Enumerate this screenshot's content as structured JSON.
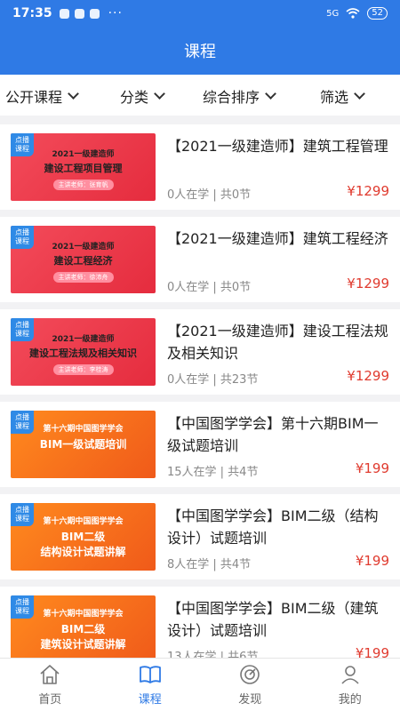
{
  "status": {
    "time": "17:35",
    "dots": "···",
    "network": "5G",
    "battery": "52"
  },
  "header": {
    "title": "课程"
  },
  "filters": [
    {
      "label": "公开课程"
    },
    {
      "label": "分类"
    },
    {
      "label": "综合排序"
    },
    {
      "label": "筛选"
    }
  ],
  "courses": [
    {
      "badge": "点播课程",
      "thumb_top": "2021一级建造师",
      "thumb_main": "建设工程项目管理",
      "thumb_sub": "主讲老师：张育帆",
      "title": "【2021一级建造师】建筑工程管理",
      "meta": "0人在学 | 共0节",
      "price": "¥1299",
      "theme": "red"
    },
    {
      "badge": "点播课程",
      "thumb_top": "2021一级建造师",
      "thumb_main": "建设工程经济",
      "thumb_sub": "主讲老师：徐沛舟",
      "title": "【2021一级建造师】建筑工程经济",
      "meta": "0人在学 | 共0节",
      "price": "¥1299",
      "theme": "red"
    },
    {
      "badge": "点播课程",
      "thumb_top": "2021一级建造师",
      "thumb_main": "建设工程法规及相关知识",
      "thumb_sub": "主讲老师：李桂涛",
      "title": "【2021一级建造师】建设工程法规及相关知识",
      "meta": "0人在学 | 共23节",
      "price": "¥1299",
      "theme": "red"
    },
    {
      "badge": "点播课程",
      "thumb_top": "第十六期中国图学学会",
      "thumb_main": "BIM一级试题培训",
      "thumb_sub": "",
      "title": "【中国图学学会】第十六期BIM一级试题培训",
      "meta": "15人在学 | 共4节",
      "price": "¥199",
      "theme": "orange"
    },
    {
      "badge": "点播课程",
      "thumb_top": "第十六期中国图学学会",
      "thumb_main": "BIM二级",
      "thumb_sub": "结构设计试题讲解",
      "title": "【中国图学学会】BIM二级（结构设计）试题培训",
      "meta": "8人在学 | 共4节",
      "price": "¥199",
      "theme": "orange"
    },
    {
      "badge": "点播课程",
      "thumb_top": "第十六期中国图学学会",
      "thumb_main": "BIM二级",
      "thumb_sub": "建筑设计试题讲解",
      "title": "【中国图学学会】BIM二级（建筑设计）试题培训",
      "meta": "13人在学 | 共6节",
      "price": "¥199",
      "theme": "orange"
    }
  ],
  "tabs": [
    {
      "label": "首页",
      "icon": "home-icon"
    },
    {
      "label": "课程",
      "icon": "book-icon"
    },
    {
      "label": "发现",
      "icon": "compass-icon"
    },
    {
      "label": "我的",
      "icon": "user-icon"
    }
  ]
}
